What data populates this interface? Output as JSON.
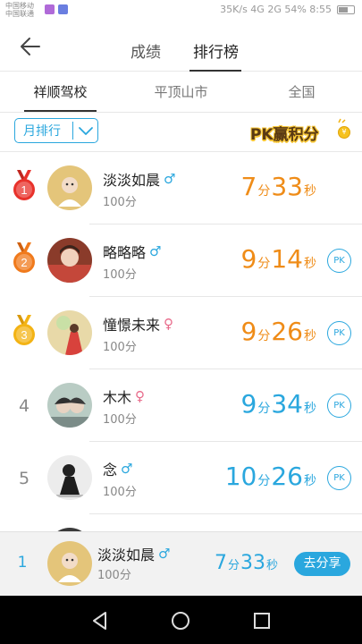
{
  "status_bar": {
    "carrier_line1": "中国移动",
    "carrier_line2": "中国联通",
    "right_text": "35K/s  4G 2G 54%  8:55"
  },
  "header": {
    "tabs": [
      {
        "label": "成绩",
        "active": false
      },
      {
        "label": "排行榜",
        "active": true
      }
    ]
  },
  "region_tabs": [
    {
      "label": "祥顺驾校",
      "active": true
    },
    {
      "label": "平顶山市",
      "active": false
    },
    {
      "label": "全国",
      "active": false
    }
  ],
  "filter": {
    "selected_period": "月排行",
    "pk_banner_text": "PK赢积分",
    "pk_coin": "¥"
  },
  "colors": {
    "accent_blue": "#2aa7de",
    "orange_time": "#ef8c18",
    "medal_red": "#e8322b",
    "medal_orange": "#f07a1c",
    "medal_gold": "#f3b314"
  },
  "ranking": [
    {
      "rank": "1",
      "medal": "red",
      "name": "淡淡如晨",
      "gender": "male",
      "score": "100分",
      "min": "7",
      "min_unit": "分",
      "sec": "33",
      "sec_unit": "秒",
      "time_color": "orange",
      "pk": false
    },
    {
      "rank": "2",
      "medal": "orange",
      "name": "略略略",
      "gender": "male",
      "score": "100分",
      "min": "9",
      "min_unit": "分",
      "sec": "14",
      "sec_unit": "秒",
      "time_color": "orange",
      "pk": true,
      "pk_label": "PK"
    },
    {
      "rank": "3",
      "medal": "gold",
      "name": "憧憬未来",
      "gender": "female",
      "score": "100分",
      "min": "9",
      "min_unit": "分",
      "sec": "26",
      "sec_unit": "秒",
      "time_color": "orange",
      "pk": true,
      "pk_label": "PK"
    },
    {
      "rank": "4",
      "medal": "none",
      "name": "木木",
      "gender": "female",
      "score": "100分",
      "min": "9",
      "min_unit": "分",
      "sec": "34",
      "sec_unit": "秒",
      "time_color": "blue",
      "pk": true,
      "pk_label": "PK"
    },
    {
      "rank": "5",
      "medal": "none",
      "name": "念",
      "gender": "male",
      "score": "100分",
      "min": "10",
      "min_unit": "分",
      "sec": "26",
      "sec_unit": "秒",
      "time_color": "blue",
      "pk": true,
      "pk_label": "PK"
    }
  ],
  "my_rank": {
    "rank": "1",
    "name": "淡淡如晨",
    "gender": "male",
    "score": "100分",
    "min": "7",
    "min_unit": "分",
    "sec": "33",
    "sec_unit": "秒",
    "share_label": "去分享"
  },
  "icons": {
    "back": "back-arrow-icon",
    "male": "♂",
    "female": "♀"
  }
}
